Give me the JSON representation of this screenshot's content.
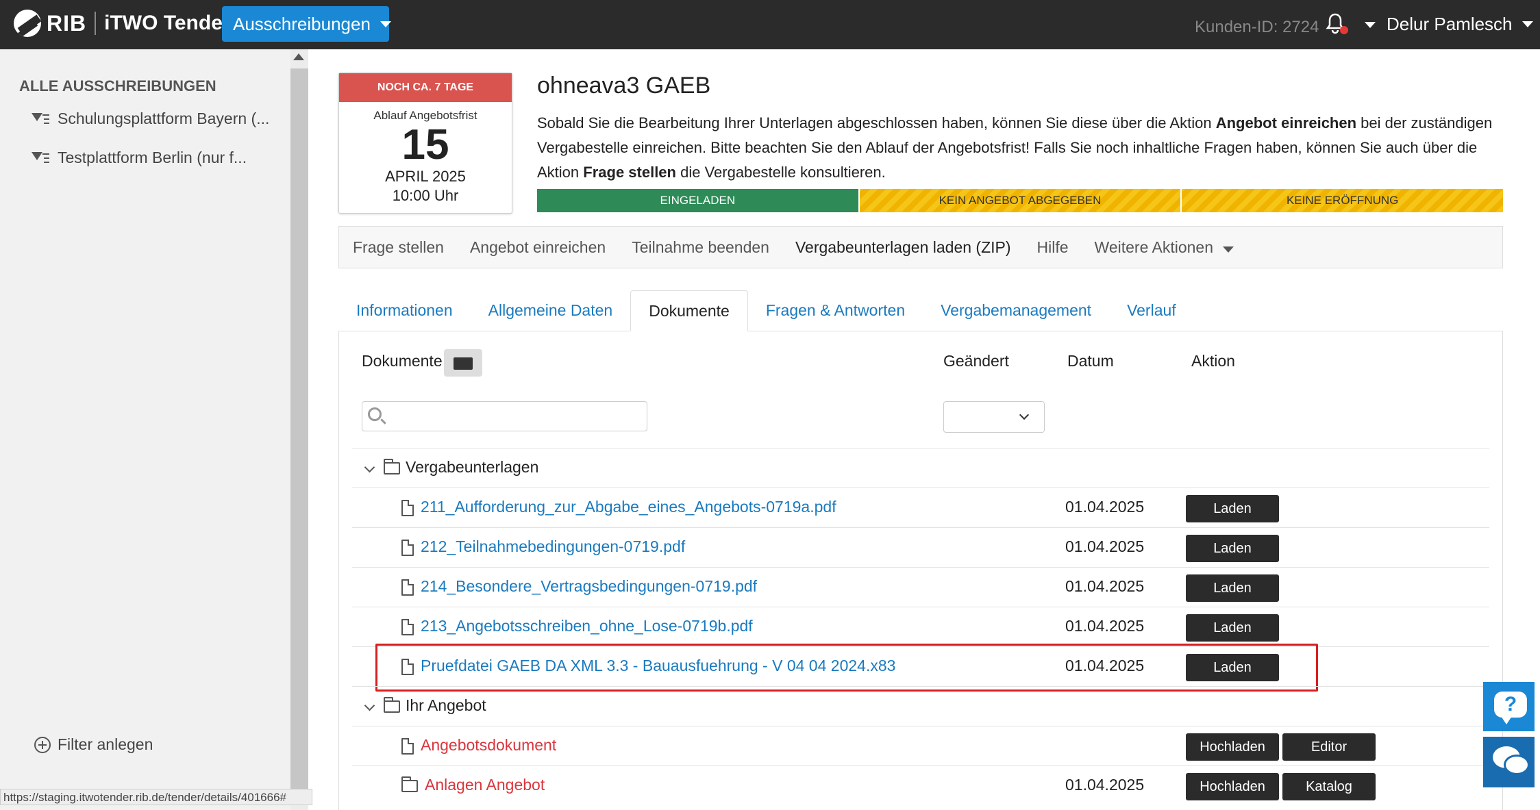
{
  "brand": {
    "rib": "RIB",
    "app": "iTWO Tender"
  },
  "topbar": {
    "menu_label": "Ausschreibungen",
    "kunden_id": "Kunden-ID: 2724",
    "user_name": "Delur Pamlesch"
  },
  "sidebar": {
    "heading": "ALLE AUSSCHREIBUNGEN",
    "items": [
      {
        "label": "Schulungsplattform Bayern (..."
      },
      {
        "label": "Testplattform Berlin (nur f..."
      }
    ],
    "add_filter": "Filter anlegen"
  },
  "status_url": "https://staging.itwotender.rib.de/tender/details/401666#",
  "deadline": {
    "badge": "NOCH CA. 7 TAGE",
    "label": "Ablauf Angebotsfrist",
    "day": "15",
    "month_year": "APRIL 2025",
    "time": "10:00 Uhr"
  },
  "tender": {
    "title": "ohneava3 GAEB",
    "desc_1": "Sobald Sie die Bearbeitung Ihrer Unterlagen abgeschlossen haben, können Sie diese über die Aktion ",
    "desc_b1": "Angebot einreichen",
    "desc_2": " bei der zuständigen Vergabestelle einreichen. Bitte beachten Sie den Ablauf der Angebotsfrist! Falls Sie noch inhaltliche Fragen haben, können Sie auch über die Aktion ",
    "desc_b2": "Frage stellen",
    "desc_3": " die Vergabestelle konsultieren."
  },
  "progress": [
    {
      "label": "EINGELADEN",
      "color": "#2e8b57"
    },
    {
      "label": "KEIN ANGEBOT ABGEGEBEN",
      "color": "#f5c518"
    },
    {
      "label": "KEINE ERÖFFNUNG",
      "color": "#f5c518"
    }
  ],
  "actions": {
    "ask": "Frage stellen",
    "submit": "Angebot einreichen",
    "end": "Teilnahme beenden",
    "download_zip": "Vergabeunterlagen laden (ZIP)",
    "help": "Hilfe",
    "more": "Weitere Aktionen"
  },
  "tabs": [
    "Informationen",
    "Allgemeine Daten",
    "Dokumente",
    "Fragen & Antworten",
    "Vergabemanagement",
    "Verlauf"
  ],
  "table": {
    "headers": {
      "documents": "Dokumente",
      "changed": "Geändert",
      "date": "Datum",
      "action": "Aktion"
    },
    "search_placeholder": "",
    "groups": [
      {
        "name": "Vergabeunterlagen"
      },
      {
        "name": "Ihr Angebot"
      }
    ],
    "files": [
      {
        "name": "211_Aufforderung_zur_Abgabe_eines_Angebots-0719a.pdf",
        "date": "01.04.2025",
        "action": "Laden"
      },
      {
        "name": "212_Teilnahmebedingungen-0719.pdf",
        "date": "01.04.2025",
        "action": "Laden"
      },
      {
        "name": "214_Besondere_Vertragsbedingungen-0719.pdf",
        "date": "01.04.2025",
        "action": "Laden"
      },
      {
        "name": "213_Angebotsschreiben_ohne_Lose-0719b.pdf",
        "date": "01.04.2025",
        "action": "Laden"
      },
      {
        "name": "Pruefdatei GAEB DA XML 3.3 - Bauausfuehrung - V 04 04 2024.x83",
        "date": "01.04.2025",
        "action": "Laden"
      }
    ],
    "offer": [
      {
        "name": "Angebotsdokument",
        "date": "",
        "action1": "Hochladen",
        "action2": "Editor"
      },
      {
        "name": "Anlagen Angebot",
        "date": "01.04.2025",
        "action1": "Hochladen",
        "action2": "Katalog"
      }
    ]
  },
  "colors": {
    "accent": "#1a88d4",
    "topbar": "#2b2b2b",
    "danger": "#d9534f",
    "link": "#1a7abf",
    "highlight": "#d81e1e"
  }
}
